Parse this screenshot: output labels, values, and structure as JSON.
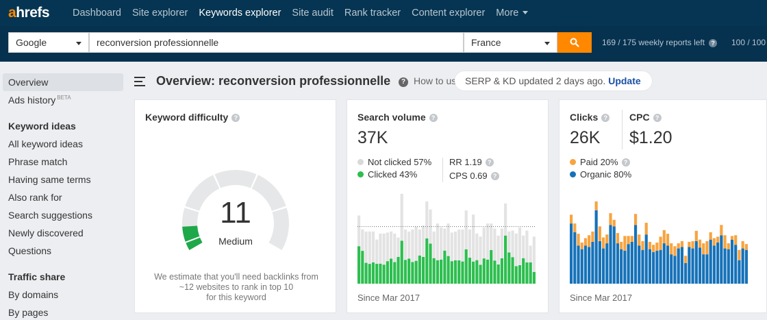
{
  "app": {
    "logo_a": "a",
    "logo_rest": "hrefs"
  },
  "nav": {
    "items": [
      {
        "label": "Dashboard",
        "active": false
      },
      {
        "label": "Site explorer",
        "active": false
      },
      {
        "label": "Keywords explorer",
        "active": true
      },
      {
        "label": "Site audit",
        "active": false
      },
      {
        "label": "Rank tracker",
        "active": false
      },
      {
        "label": "Content explorer",
        "active": false
      },
      {
        "label": "More",
        "active": false
      }
    ]
  },
  "search": {
    "engine": "Google",
    "keyword": "reconversion professionnelle",
    "country": "France",
    "reports_left": "169 / 175 weekly reports left",
    "reports_right": "100 / 100"
  },
  "sidebar": {
    "overview": "Overview",
    "ads_history": "Ads history",
    "beta": "BETA",
    "keyword_ideas": "Keyword ideas",
    "ideas": [
      "All keyword ideas",
      "Phrase match",
      "Having same terms",
      "Also rank for",
      "Search suggestions",
      "Newly discovered",
      "Questions"
    ],
    "traffic_share": "Traffic share",
    "traffic": [
      "By domains",
      "By pages"
    ]
  },
  "header": {
    "title": "Overview: reconversion professionnelle",
    "howto": "How to use",
    "serp_text": "SERP & KD updated 2 days ago.",
    "serp_link": "Update"
  },
  "kd_card": {
    "title": "Keyword difficulty",
    "value": "11",
    "level": "Medium",
    "gauge_fraction": 0.11,
    "note_line1": "We estimate that you'll need backlinks from",
    "note_line2": "~12 websites to rank in top 10",
    "note_line3": "for this keyword"
  },
  "sv_card": {
    "title": "Search volume",
    "value": "37K",
    "not_clicked": "Not clicked 57%",
    "clicked": "Clicked 43%",
    "rr": "RR 1.19",
    "cps": "CPS 0.69",
    "since": "Since Mar 2017"
  },
  "clicks_card": {
    "clicks_title": "Clicks",
    "clicks_value": "26K",
    "cpc_title": "CPC",
    "cpc_value": "$1.20",
    "paid": "Paid 20%",
    "organic": "Organic 80%",
    "since": "Since Mar 2017"
  },
  "colors": {
    "nav_bg": "#053552",
    "accent": "#ff8800",
    "green": "#2dbe4f",
    "gray_bar": "#e0e0e0",
    "blue": "#1672b8",
    "orange": "#f7a440"
  },
  "chart_data": [
    {
      "type": "bar",
      "stacked": true,
      "series": [
        {
          "name": "Clicked",
          "values": [
            0.55,
            0.52,
            0.4,
            0.38,
            0.41,
            0.45,
            0.4,
            0.38,
            0.44,
            0.48,
            0.43,
            0.58,
            0.55,
            0.44,
            0.48,
            0.4,
            0.4,
            0.52,
            0.46,
            0.55,
            0.54,
            0.49,
            0.39,
            0.43,
            0.6,
            0.46,
            0.44,
            0.45,
            0.43,
            0.41,
            0.47,
            0.48,
            0.32,
            0.47,
            0.4,
            0.45,
            0.4,
            0.56,
            0.42,
            0.4,
            0.46,
            0.6,
            0.6,
            0.5,
            0.35,
            0.33,
            0.53,
            0.4,
            0.56,
            0.25
          ]
        },
        {
          "name": "Not clicked",
          "values": [
            0.45,
            0.34,
            0.6,
            0.62,
            0.59,
            0.55,
            0.6,
            0.62,
            0.56,
            0.52,
            0.57,
            0.42,
            0.6,
            0.56,
            0.52,
            0.6,
            0.6,
            0.48,
            0.54,
            0.45,
            0.46,
            0.51,
            0.61,
            0.57,
            0.4,
            0.54,
            0.56,
            0.55,
            0.57,
            0.59,
            0.53,
            0.52,
            0.68,
            0.53,
            0.6,
            0.55,
            0.6,
            0.44,
            0.58,
            0.6,
            0.54,
            0.4,
            0.4,
            0.5,
            0.65,
            0.67,
            0.47,
            0.6,
            0.44,
            0.75
          ]
        }
      ],
      "totals": [
        68,
        63,
        52,
        52,
        52,
        44,
        50,
        50,
        51,
        52,
        50,
        46,
        78,
        54,
        52,
        54,
        57,
        54,
        58,
        82,
        74,
        52,
        60,
        56,
        55,
        60,
        51,
        52,
        54,
        54,
        73,
        54,
        69,
        50,
        47,
        56,
        60,
        60,
        55,
        48,
        55,
        80,
        52,
        53,
        50,
        56,
        48,
        53,
        38,
        47
      ],
      "xlabel": "Since Mar 2017"
    },
    {
      "type": "bar",
      "stacked": true,
      "series": [
        {
          "name": "Organic",
          "values": [
            82,
            70,
            52,
            47,
            52,
            50,
            57,
            100,
            58,
            48,
            55,
            80,
            78,
            55,
            47,
            45,
            54,
            57,
            80,
            52,
            46,
            67,
            47,
            43,
            45,
            46,
            55,
            52,
            40,
            38,
            48,
            50,
            28,
            50,
            48,
            58,
            49,
            40,
            40,
            60,
            52,
            56,
            66,
            48,
            47,
            60,
            53,
            32,
            48,
            46
          ]
        },
        {
          "name": "Paid",
          "values": [
            12,
            12,
            16,
            9,
            10,
            16,
            14,
            12,
            20,
            15,
            12,
            16,
            9,
            14,
            10,
            20,
            11,
            8,
            15,
            15,
            12,
            16,
            10,
            10,
            11,
            18,
            18,
            16,
            15,
            13,
            7,
            8,
            10,
            7,
            10,
            14,
            11,
            15,
            18,
            10,
            10,
            8,
            14,
            18,
            8,
            5,
            13,
            14,
            10,
            8
          ]
        }
      ],
      "xlabel": "Since Mar 2017"
    }
  ]
}
